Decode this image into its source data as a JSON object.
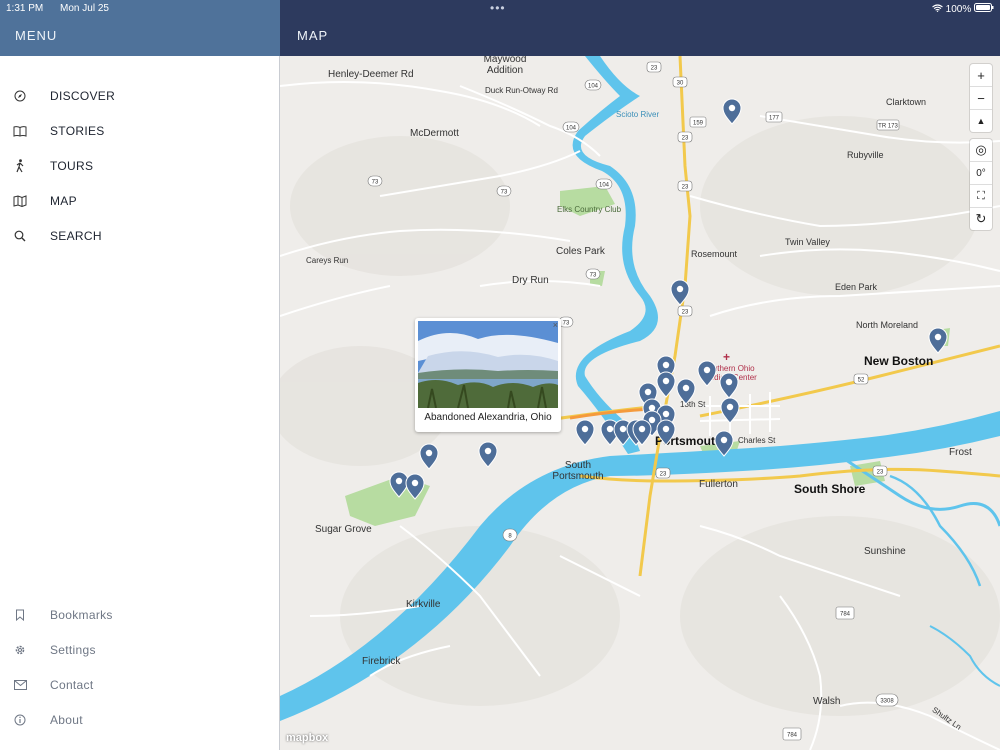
{
  "status": {
    "time": "1:31 PM",
    "date": "Mon Jul 25",
    "battery": "100%"
  },
  "sidebar": {
    "title": "MENU",
    "items": [
      {
        "label": "DISCOVER",
        "icon": "compass-icon"
      },
      {
        "label": "STORIES",
        "icon": "book-icon"
      },
      {
        "label": "TOURS",
        "icon": "walking-icon"
      },
      {
        "label": "MAP",
        "icon": "map-icon"
      },
      {
        "label": "SEARCH",
        "icon": "search-icon"
      }
    ],
    "bottom_items": [
      {
        "label": "Bookmarks",
        "icon": "bookmark-icon"
      },
      {
        "label": "Settings",
        "icon": "gear-icon"
      },
      {
        "label": "Contact",
        "icon": "mail-icon"
      },
      {
        "label": "About",
        "icon": "info-icon"
      }
    ]
  },
  "map": {
    "title": "MAP",
    "popup": {
      "title": "Abandoned Alexandria, Ohio",
      "close": "×"
    },
    "controls": {
      "zoom_in": "+",
      "zoom_out": "−",
      "compass": "▲",
      "locate": "◎",
      "bearing": "0°",
      "fullscreen": "⛶",
      "reset": "↻"
    },
    "attribution": "mapbox",
    "places": [
      "Henley-Deemer Rd",
      "Maywood Addition",
      "Duck Run-Otway Rd",
      "McDermott",
      "Elks Country Club",
      "Coles Park",
      "Dry Run",
      "Careys Run",
      "Clarktown",
      "Rubyville",
      "Twin Valley",
      "Rosemount",
      "Eden Park",
      "North Moreland",
      "New Boston",
      "South Portsmouth",
      "Fullerton",
      "South Shore",
      "Frost",
      "Sunshine",
      "Sugar Grove",
      "Kirkville",
      "Firebrick",
      "Walsh",
      "Shultz Ln",
      "Portsmouth",
      "13th St",
      "Charles St",
      "Scioto River",
      "Southern Ohio Medical Center"
    ],
    "route_shields": [
      "23",
      "30",
      "104",
      "159",
      "177",
      "73",
      "52",
      "8",
      "784",
      "3308",
      "TR 173"
    ]
  },
  "colors": {
    "sidebar_header": "#4f729a",
    "map_header": "#2d3a5e",
    "river": "#5fc4ec",
    "marker": "#4e6e99",
    "park": "#b7dca1"
  }
}
